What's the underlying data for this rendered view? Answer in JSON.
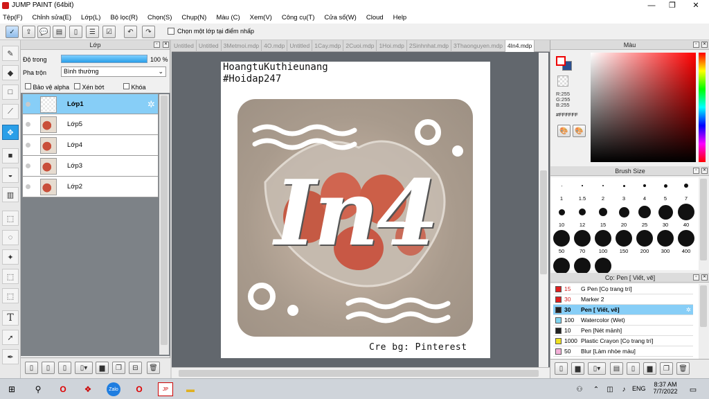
{
  "app": {
    "title": "JUMP PAINT (64bit)"
  },
  "menu": [
    "Tệp(F)",
    "Chỉnh sửa(E)",
    "Lớp(L)",
    "Bộ lọc(R)",
    "Chọn(S)",
    "Chụp(N)",
    "Màu (C)",
    "Xem(V)",
    "Công cụ(T)",
    "Cửa sổ(W)",
    "Cloud",
    "Help"
  ],
  "toolbar": {
    "pick_layer_label": "Chọn một lớp tại điểm nhấp"
  },
  "layer_panel": {
    "title": "Lớp",
    "opacity_label": "Độ trong",
    "opacity_value": "100 %",
    "opacity_pct": 100,
    "blend_label": "Pha trộn",
    "blend_value": "Bình thường",
    "protect_alpha": "Bảo vệ alpha",
    "clipping": "Xén bớt",
    "lock": "Khóa",
    "layers": [
      {
        "name": "Lớp1"
      },
      {
        "name": "Lớp5"
      },
      {
        "name": "Lớp4"
      },
      {
        "name": "Lớp3"
      },
      {
        "name": "Lớp2"
      }
    ]
  },
  "doc_tabs": [
    "Untitled",
    "Untitled",
    "3Metmoi.mdp",
    "4O.mdp",
    "Untitled",
    "1Cay.mdp",
    "2Cuoi.mdp",
    "1Hoi.mdp",
    "2Sinhnhat.mdp",
    "3Thaonguyen.mdp",
    "4In4.mdp"
  ],
  "artwork": {
    "line1": "HoangtuKuthieunang",
    "line2": "#Hoidap247",
    "center_text": "In4",
    "credit": "Cre bg: Pinterest"
  },
  "color_panel": {
    "title": "Màu",
    "r": "R:255",
    "g": "G:255",
    "b": "B:255",
    "hex": "#FFFFFF",
    "fg": "#ffffff",
    "bg": "#2b4f8e"
  },
  "brush_size": {
    "title": "Brush Size",
    "sizes": [
      "1",
      "1.5",
      "2",
      "3",
      "4",
      "5",
      "7",
      "10",
      "12",
      "15",
      "20",
      "25",
      "30",
      "40",
      "50",
      "70",
      "100",
      "150",
      "200",
      "300",
      "400"
    ]
  },
  "brush_list": {
    "title": "Cọ: Pen [ Viết, vẽ]",
    "items": [
      {
        "size": "15",
        "name": "G Pen [Cọ trang trí]",
        "color": "#e02020"
      },
      {
        "size": "30",
        "name": "Marker 2",
        "color": "#e02020"
      },
      {
        "size": "30",
        "name": "Pen [ Viết, vẽ]",
        "color": "#222222"
      },
      {
        "size": "100",
        "name": "Watercolor (Wet)",
        "color": "#7fd4f0"
      },
      {
        "size": "10",
        "name": "Pen [Nét mảnh]",
        "color": "#222222"
      },
      {
        "size": "1000",
        "name": "Plastic Crayon [Cọ trang trí]",
        "color": "#f0e020"
      },
      {
        "size": "50",
        "name": "Blur [Làm nhòe màu]",
        "color": "#f4b0d8"
      }
    ]
  },
  "taskbar": {
    "time": "8:37 AM",
    "date": "7/7/2022",
    "lang": "ENG"
  }
}
